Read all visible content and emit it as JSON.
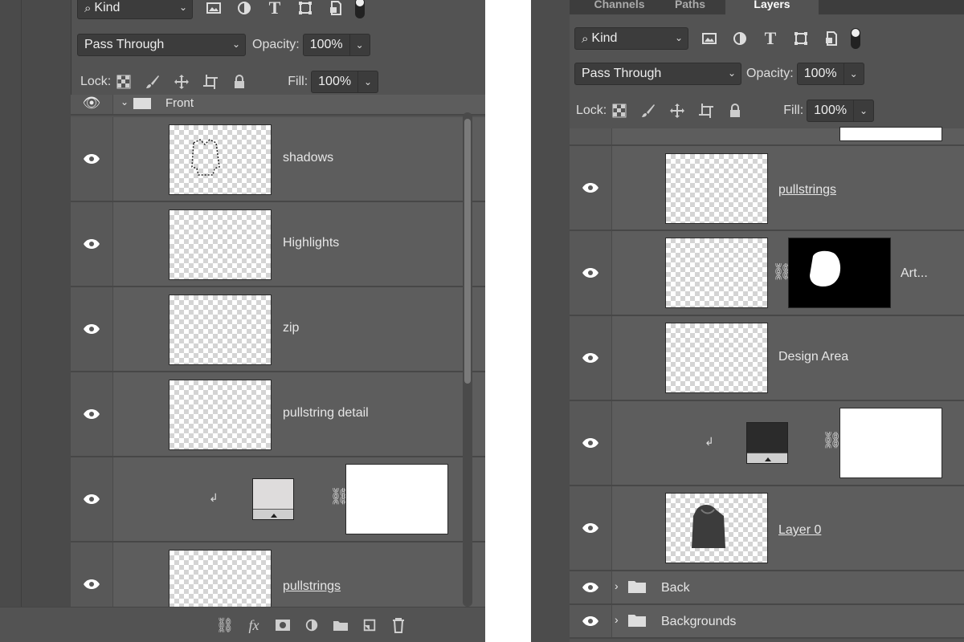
{
  "left": {
    "filter": {
      "kind_label": "Kind"
    },
    "blend_mode": "Pass Through",
    "opacity_label": "Opacity:",
    "opacity_value": "100%",
    "lock_label": "Lock:",
    "fill_label": "Fill:",
    "fill_value": "100%",
    "group_name": "Front",
    "layers": [
      {
        "name": "shadows"
      },
      {
        "name": "Highlights"
      },
      {
        "name": "zip"
      },
      {
        "name": "pullstring detail"
      },
      {
        "name": ""
      },
      {
        "name": "pullstrings"
      }
    ]
  },
  "right": {
    "tabs": [
      "Channels",
      "Paths",
      "Layers"
    ],
    "filter": {
      "kind_label": "Kind"
    },
    "blend_mode": "Pass Through",
    "opacity_label": "Opacity:",
    "opacity_value": "100%",
    "lock_label": "Lock:",
    "fill_label": "Fill:",
    "fill_value": "100%",
    "layers": [
      {
        "name": "pullstrings"
      },
      {
        "name": "Art..."
      },
      {
        "name": "Design Area"
      },
      {
        "name": ""
      },
      {
        "name": "Layer 0"
      }
    ],
    "folders": [
      {
        "name": "Back"
      },
      {
        "name": "Backgrounds"
      }
    ]
  },
  "colors": {
    "panel_bg": "#535353",
    "row_bg": "#5d5d5d",
    "accent": "#ffffff"
  }
}
